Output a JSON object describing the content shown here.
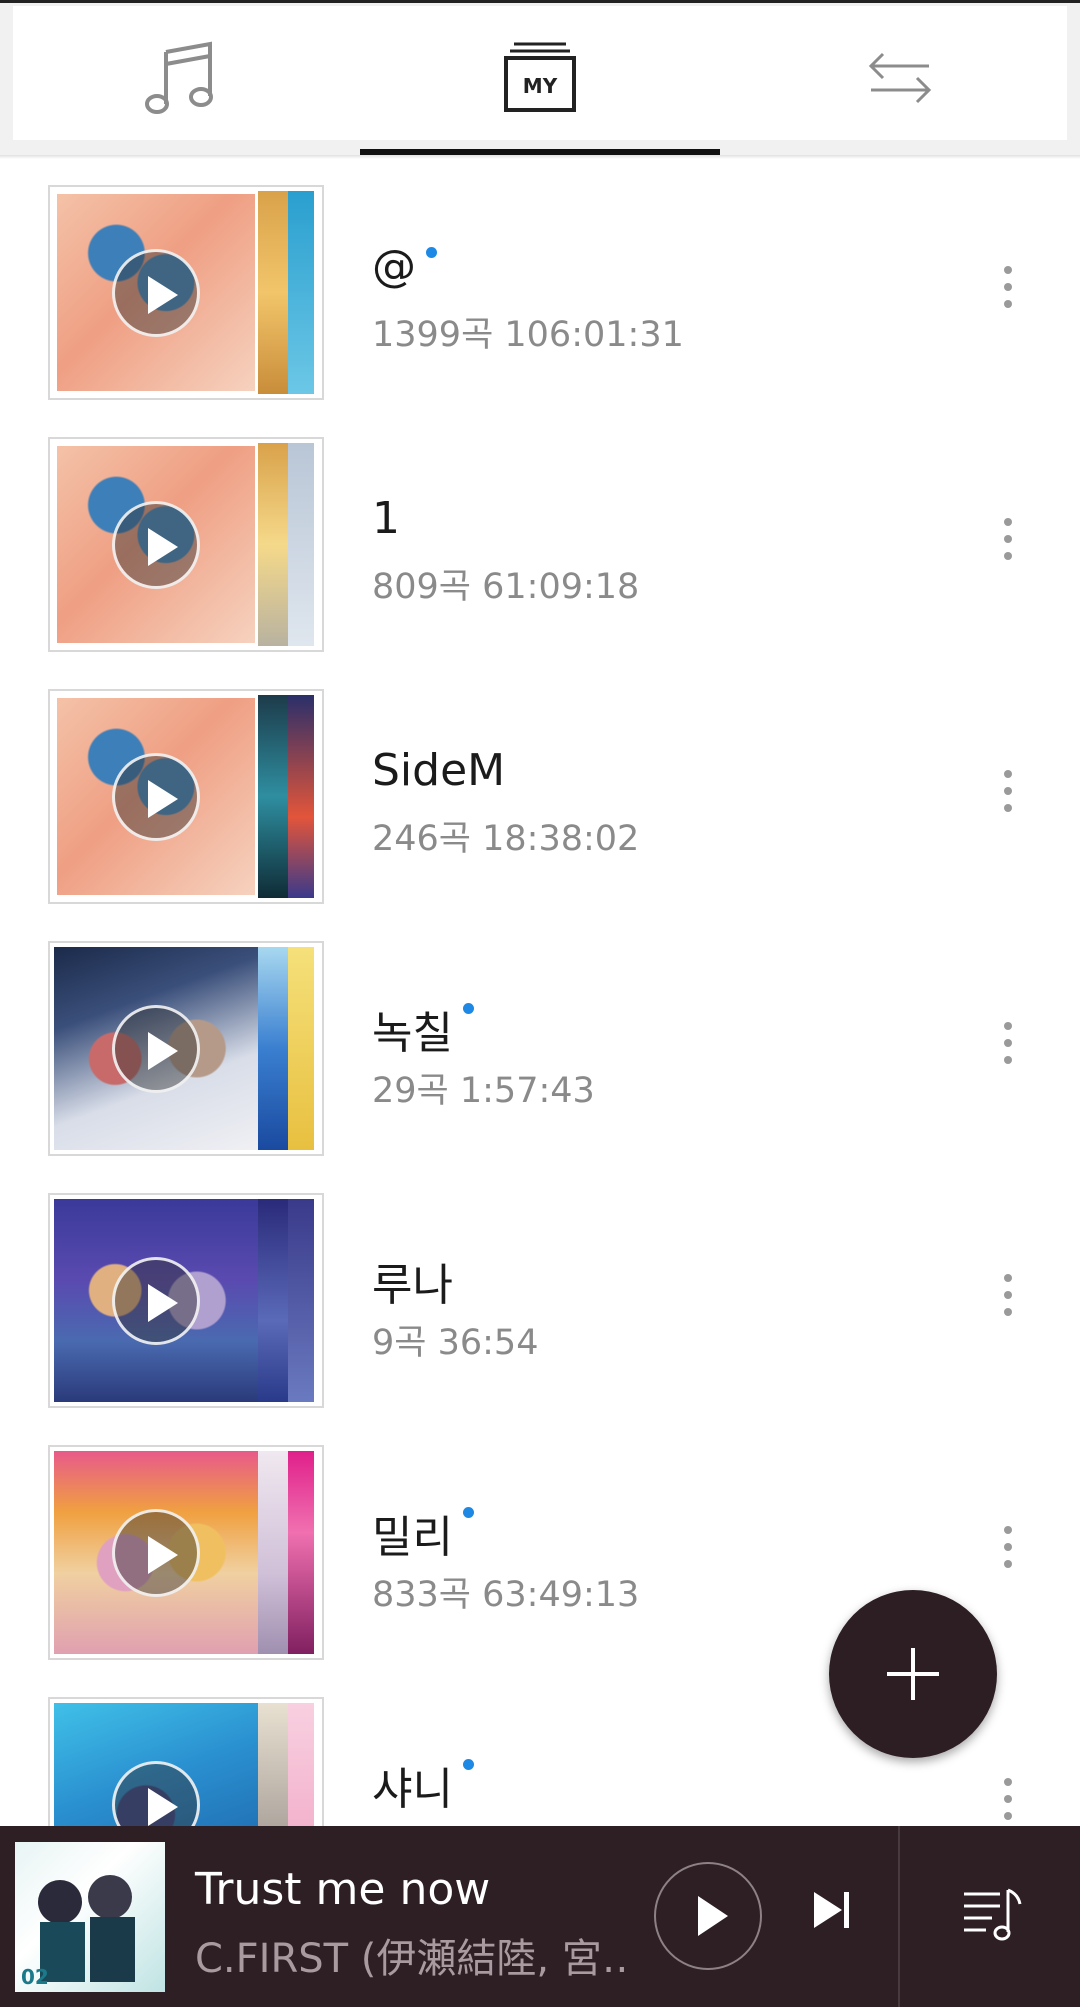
{
  "tabs": {
    "music_icon": "music-note-icon",
    "my_label": "MY",
    "transfer_icon": "transfer-arrows-icon"
  },
  "playlists": [
    {
      "title": "@",
      "new": true,
      "meta": "1399곡  106:01:31"
    },
    {
      "title": "1",
      "new": false,
      "meta": "809곡  61:09:18"
    },
    {
      "title": "SideM",
      "new": false,
      "meta": "246곡  18:38:02"
    },
    {
      "title": "녹칠",
      "new": true,
      "meta": "29곡  1:57:43"
    },
    {
      "title": "루나",
      "new": false,
      "meta": "9곡  36:54"
    },
    {
      "title": "밀리",
      "new": true,
      "meta": "833곡  63:49:13"
    },
    {
      "title": "샤니",
      "new": true,
      "meta": ""
    }
  ],
  "fab": {
    "icon": "plus-icon"
  },
  "player": {
    "track_title": "Trust me now",
    "artist": "C.FIRST (伊瀬結陸, 宮…",
    "play_icon": "play-icon",
    "next_icon": "skip-next-icon",
    "queue_icon": "queue-music-icon"
  },
  "colors": {
    "accent_dot": "#1e88e5",
    "player_bg": "#2d1f24",
    "fab_bg": "#2c1e22"
  }
}
